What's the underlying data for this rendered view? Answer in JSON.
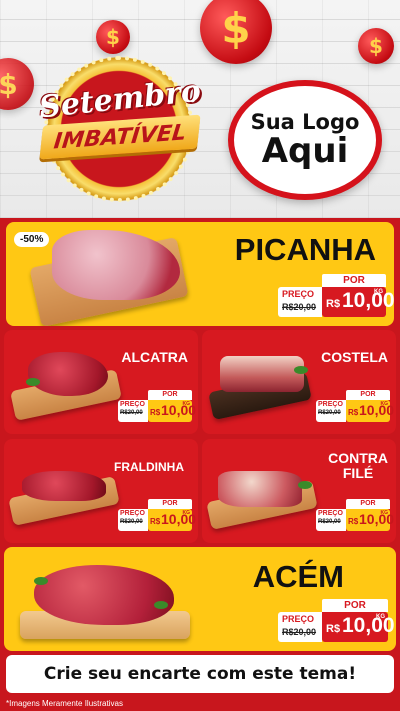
{
  "header": {
    "badge_line1": "Setembro",
    "badge_line2": "IMBATÍVEL",
    "logo_line1": "Sua Logo",
    "logo_line2": "Aqui",
    "coin_symbol": "$"
  },
  "products": {
    "picanha": {
      "name": "PICANHA",
      "discount": "-50%",
      "preco_label": "PREÇO",
      "por_label": "POR",
      "old_price": "R$20,00",
      "currency": "R$",
      "price": "10,00",
      "unit": "KG"
    },
    "alcatra": {
      "name": "ALCATRA",
      "preco_label": "PREÇO",
      "por_label": "POR",
      "old_price": "R$20,00",
      "currency": "R$",
      "price": "10,00",
      "unit": "KG"
    },
    "costela": {
      "name": "COSTELA",
      "preco_label": "PREÇO",
      "por_label": "POR",
      "old_price": "R$20,00",
      "currency": "R$",
      "price": "10,00",
      "unit": "KG"
    },
    "fraldinha": {
      "name": "FRALDINHA",
      "preco_label": "PREÇO",
      "por_label": "POR",
      "old_price": "R$20,00",
      "currency": "R$",
      "price": "10,00",
      "unit": "KG"
    },
    "contrafile": {
      "name_line1": "CONTRA",
      "name_line2": "FILÉ",
      "preco_label": "PREÇO",
      "por_label": "POR",
      "old_price": "R$20,00",
      "currency": "R$",
      "price": "10,00",
      "unit": "KG"
    },
    "acem": {
      "name": "ACÉM",
      "preco_label": "PREÇO",
      "por_label": "POR",
      "old_price": "R$20,00",
      "currency": "R$",
      "price": "10,00",
      "unit": "KG"
    }
  },
  "footer": {
    "cta": "Crie seu encarte com este tema!",
    "disclaimer": "*Imagens Meramente Ilustrativas"
  },
  "colors": {
    "red": "#d71920",
    "yellow": "#ffc814",
    "dark_red": "#c8161d"
  }
}
